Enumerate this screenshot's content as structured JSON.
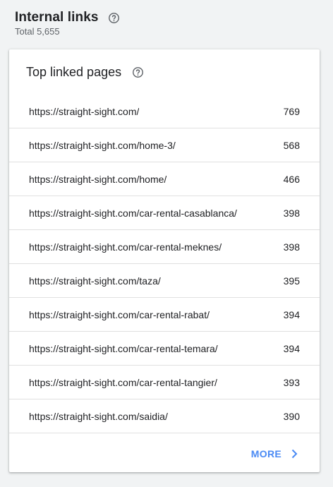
{
  "header": {
    "title": "Internal links",
    "subtitle": "Total 5,655",
    "help_icon": "help-circle-icon"
  },
  "card": {
    "title": "Top linked pages",
    "help_icon": "help-circle-icon",
    "rows": [
      {
        "url": "https://straight-sight.com/",
        "count": "769"
      },
      {
        "url": "https://straight-sight.com/home-3/",
        "count": "568"
      },
      {
        "url": "https://straight-sight.com/home/",
        "count": "466"
      },
      {
        "url": "https://straight-sight.com/car-rental-casablanca/",
        "count": "398"
      },
      {
        "url": "https://straight-sight.com/car-rental-meknes/",
        "count": "398"
      },
      {
        "url": "https://straight-sight.com/taza/",
        "count": "395"
      },
      {
        "url": "https://straight-sight.com/car-rental-rabat/",
        "count": "394"
      },
      {
        "url": "https://straight-sight.com/car-rental-temara/",
        "count": "394"
      },
      {
        "url": "https://straight-sight.com/car-rental-tangier/",
        "count": "393"
      },
      {
        "url": "https://straight-sight.com/saidia/",
        "count": "390"
      }
    ],
    "more_label": "MORE",
    "more_icon": "chevron-right-icon"
  },
  "colors": {
    "background": "#f1f3f4",
    "card": "#ffffff",
    "accent": "#4a8af4",
    "text": "#202124",
    "muted": "#5f6368",
    "divider": "#e0e0e0"
  }
}
